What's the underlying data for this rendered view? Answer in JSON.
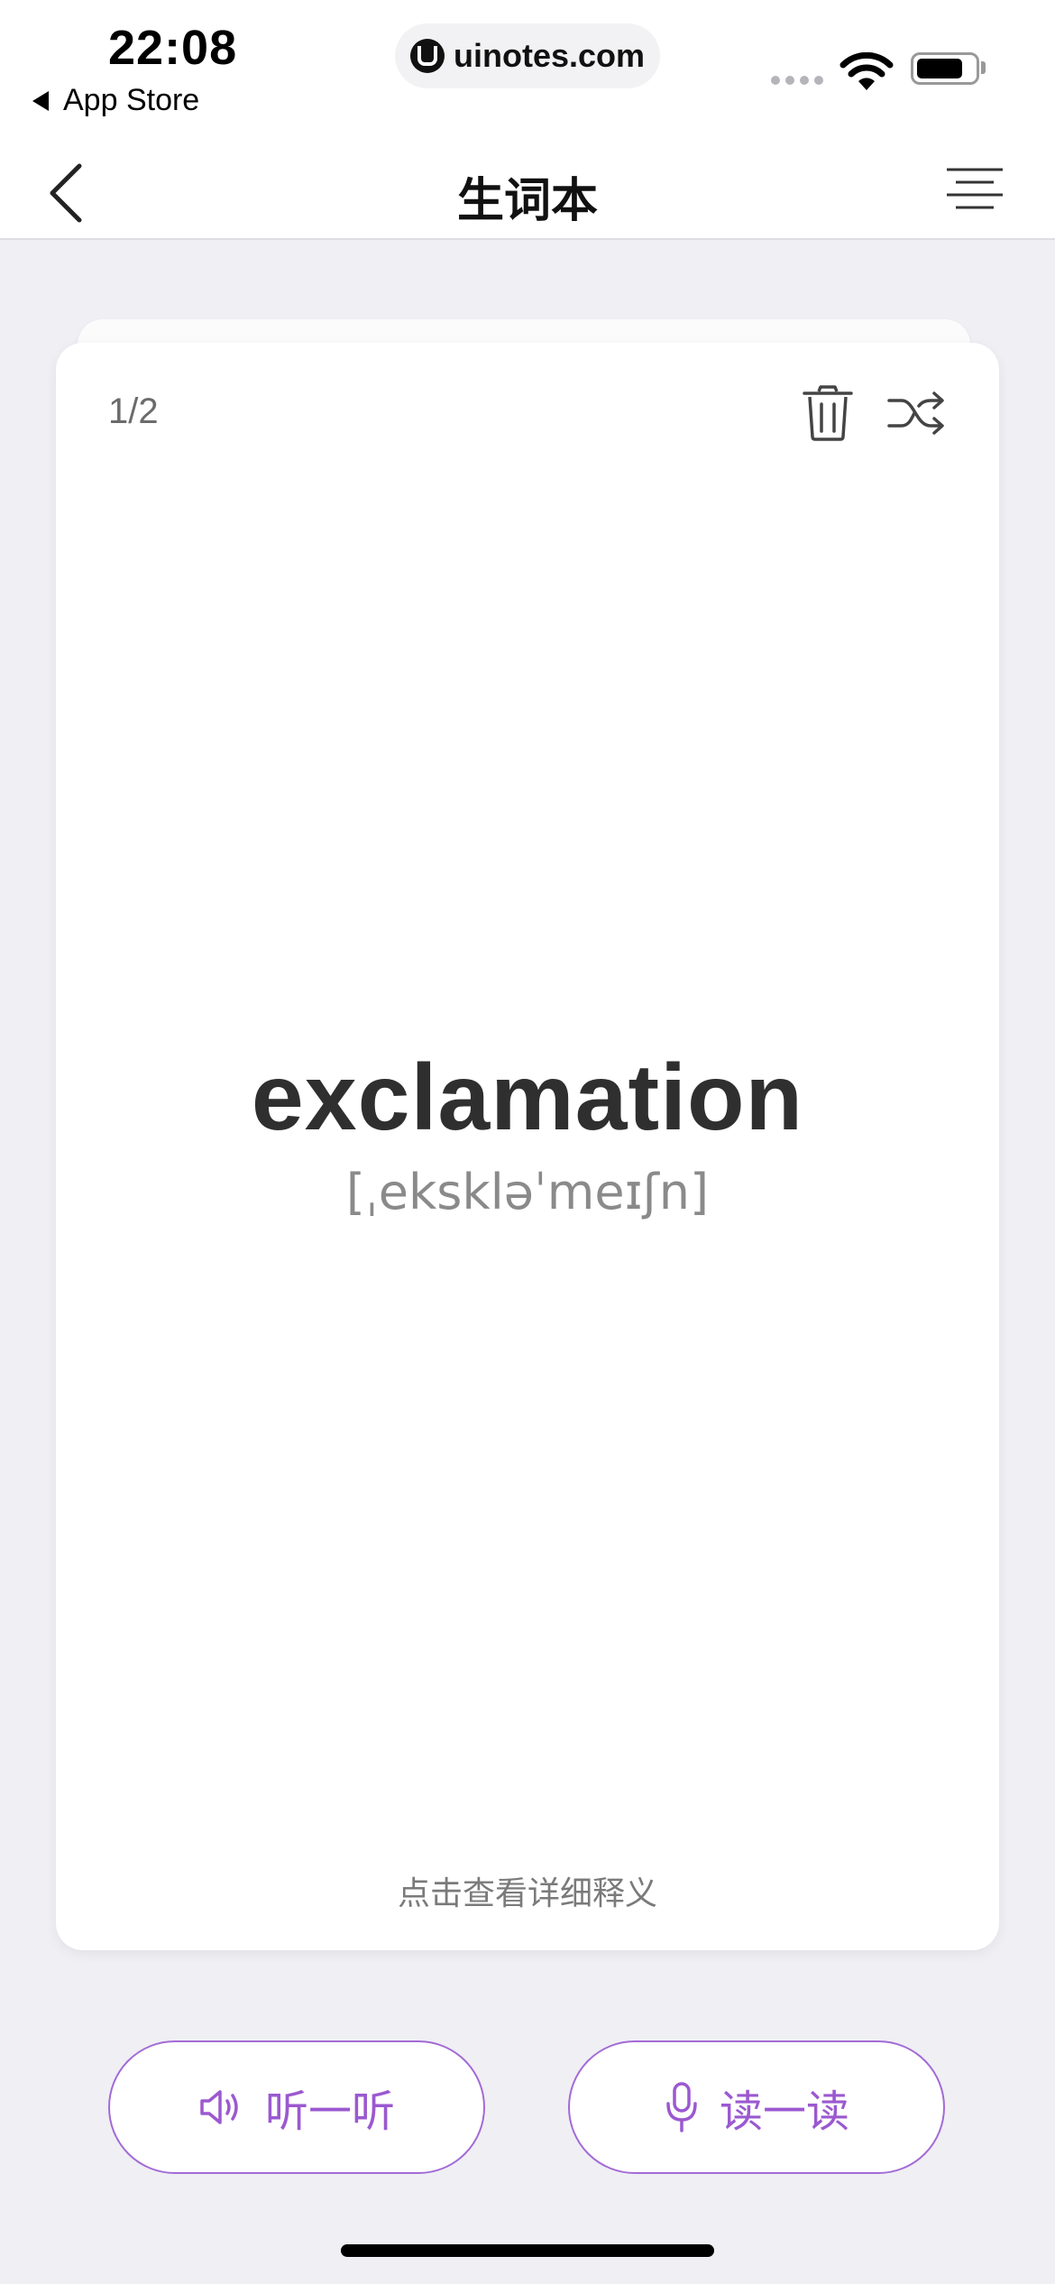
{
  "status_bar": {
    "time": "22:08",
    "back_app_label": "App Store",
    "url": "uinotes.com"
  },
  "nav": {
    "title": "生词本"
  },
  "card": {
    "counter": "1/2",
    "word": "exclamation",
    "phonetic": "[ˌekskləˈmeɪʃn]",
    "detail_hint": "点击查看详细释义"
  },
  "actions": {
    "listen_label": "听一听",
    "read_label": "读一读"
  },
  "colors": {
    "accent": "#9b59d0",
    "background": "#efeff4"
  },
  "icons": {
    "back": "chevron-left-icon",
    "menu": "menu-lines-icon",
    "delete": "trash-icon",
    "shuffle": "shuffle-icon",
    "listen": "speaker-icon",
    "read": "microphone-icon"
  }
}
